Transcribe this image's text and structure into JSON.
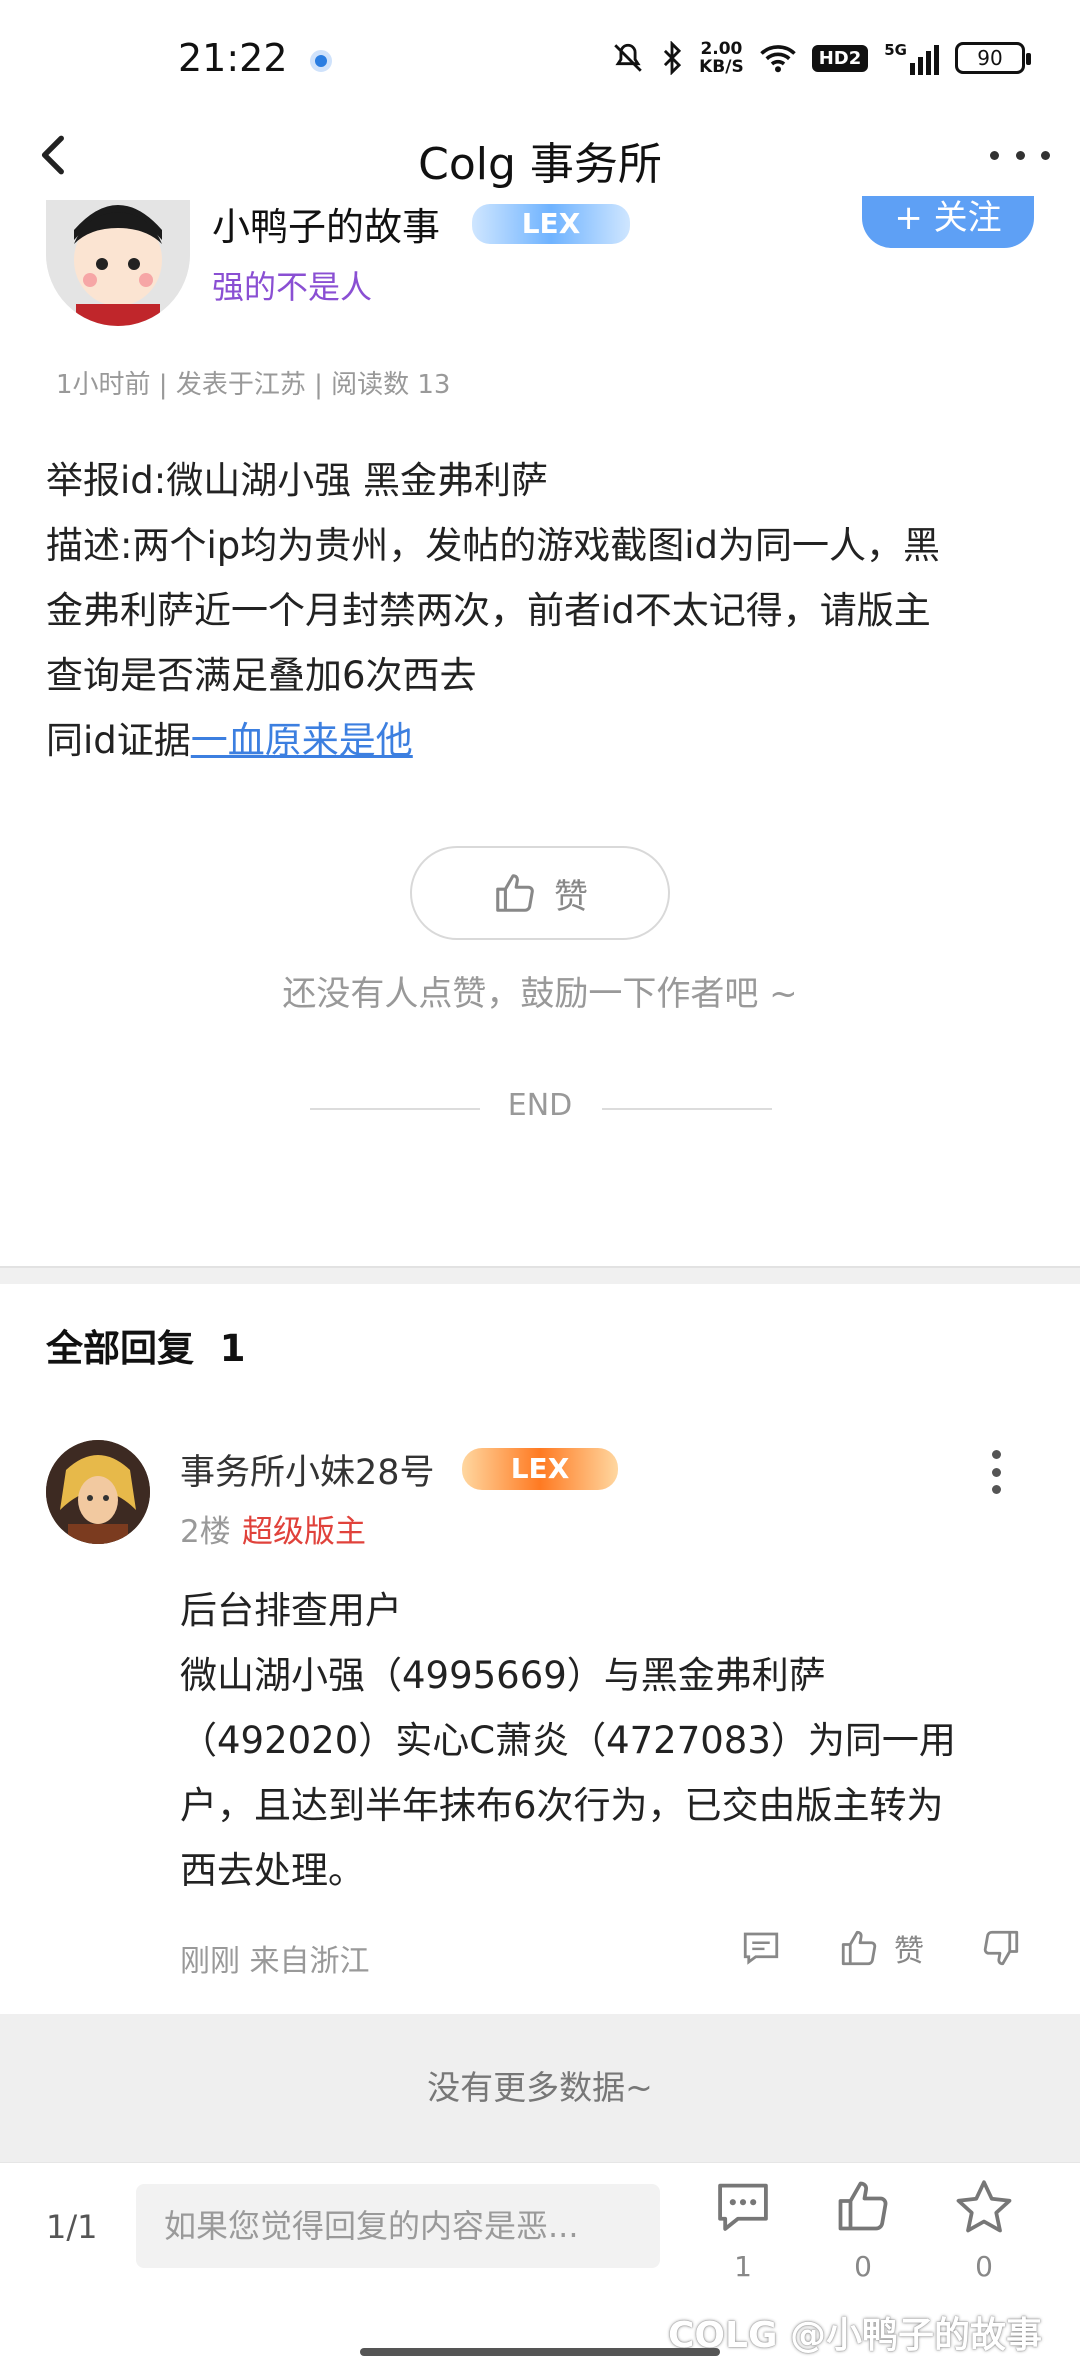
{
  "status_bar": {
    "time": "21:22",
    "net_speed_value": "2.00",
    "net_speed_unit": "KB/S",
    "hd_label": "HD2",
    "signal_label": "5G",
    "battery": "90"
  },
  "nav": {
    "title": "Colg 事务所"
  },
  "post": {
    "author_name": "小鸭子的故事",
    "author_badge": "LEX",
    "follow_label": "+ 关注",
    "author_signature": "强的不是人",
    "meta": "1小时前 | 发表于江苏 | 阅读数 13",
    "body_lines": [
      "举报id:微山湖小强 黑金弗利萨",
      "描述:两个ip均为贵州，发帖的游戏截图id为同一人，黑",
      "金弗利萨近一个月封禁两次，前者id不太记得，请版主",
      "查询是否满足叠加6次西去"
    ],
    "evidence_prefix": "同id证据",
    "evidence_link": "一血原来是他",
    "like_label": "赞",
    "like_hint": "还没有人点赞，鼓励一下作者吧 ~",
    "end_label": "END"
  },
  "replies": {
    "title": "全部回复",
    "count": "1",
    "items": [
      {
        "name": "事务所小妹28号",
        "badge": "LEX",
        "floor": "2楼",
        "role": "超级版主",
        "body_lines": [
          "后台排查用户",
          "微山湖小强（4995669）与黑金弗利萨",
          "（492020）实心C萧炎（4727083）为同一用",
          "户，且达到半年抹布6次行为，已交由版主转为",
          "西去处理。"
        ],
        "meta": "刚刚 来自浙江",
        "like_label": "赞"
      }
    ],
    "no_more": "没有更多数据~"
  },
  "bottom_bar": {
    "page_indicator": "1/1",
    "input_placeholder": "如果您觉得回复的内容是恶...",
    "comment_count": "1",
    "like_count": "0",
    "favorite_count": "0"
  },
  "watermark": "COLG @小鸭子的故事",
  "colors": {
    "link": "#3c7fe0",
    "signature": "#8a4fd3",
    "role": "#e0423b",
    "follow": "#5ea0f5"
  },
  "icons": [
    "back-icon",
    "more-icon",
    "thumbs-up-icon",
    "comment-icon",
    "thumbs-down-icon",
    "star-icon",
    "wifi-icon",
    "bluetooth-icon",
    "mute-icon",
    "signal-icon",
    "battery-icon"
  ]
}
